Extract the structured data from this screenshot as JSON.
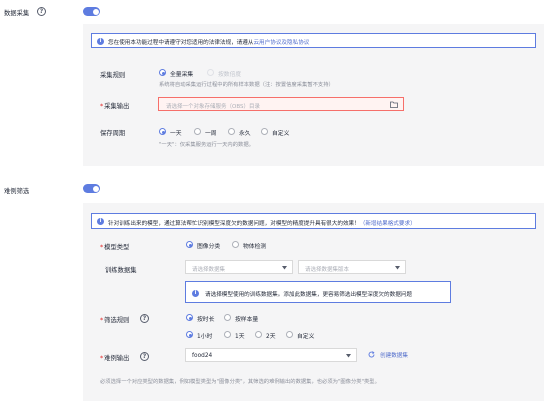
{
  "collection": {
    "label": "数据采集",
    "notice_prefix": "您在使用本功能过程中请遵守对您适用的法律法规，请遵从",
    "notice_link": "云用户协议及隐私协议",
    "rule_label": "采集规则",
    "rule_options": [
      "全量采集",
      "按数倍度"
    ],
    "rule_hint": "系统将自动采集运行过程中的所有样本数据（注：按置信度采集暂不支持）",
    "output_label": "采集输出",
    "output_placeholder": "请选择一个对象存储服务（OBS）目录",
    "period_label": "保存周期",
    "period_options": [
      "一天",
      "一周",
      "永久",
      "自定义"
    ],
    "period_hint": "\"一天\"：仅采集服务运行一天内的数据。"
  },
  "hard_mining": {
    "label": "难例筛选",
    "notice": "针对训练出来的模型，通过算法帮忙识别模型深度欠的数据问题，对模型的精度提升具有很大的效果！",
    "notice_link": "（新增结果格式要求）",
    "model_type_label": "模型类型",
    "model_type_options": [
      "图像分类",
      "物体检测"
    ],
    "dataset_label": "训练数据集",
    "dataset_placeholder": "请选择数据集",
    "version_placeholder": "请选择数据集版本",
    "dataset_notice": "请选择模型使用的训练数据集。添加此数据集，更容易筛选出模型深度欠的数据问题",
    "filter_rule_label": "筛选规则",
    "filter_rule_options": [
      "按时长",
      "按样本量"
    ],
    "duration_options": [
      "1小时",
      "1天",
      "2天",
      "自定义"
    ],
    "output_label": "难例输出",
    "output_value": "food24",
    "create_link": "创建数据集",
    "footer_hint": "必须选择一个对应类型的数据集，例如模型类型为\"图像分类\"，其筛选的难例输出的数据集，也必须为\"图像分类\"类型。"
  },
  "colors": {
    "accent": "#5e7ce0",
    "error": "#f66f6a",
    "panel": "#f5f5f6"
  },
  "icons": [
    "help-icon",
    "info-icon",
    "folder-icon",
    "chevron-down-icon",
    "refresh-icon"
  ]
}
